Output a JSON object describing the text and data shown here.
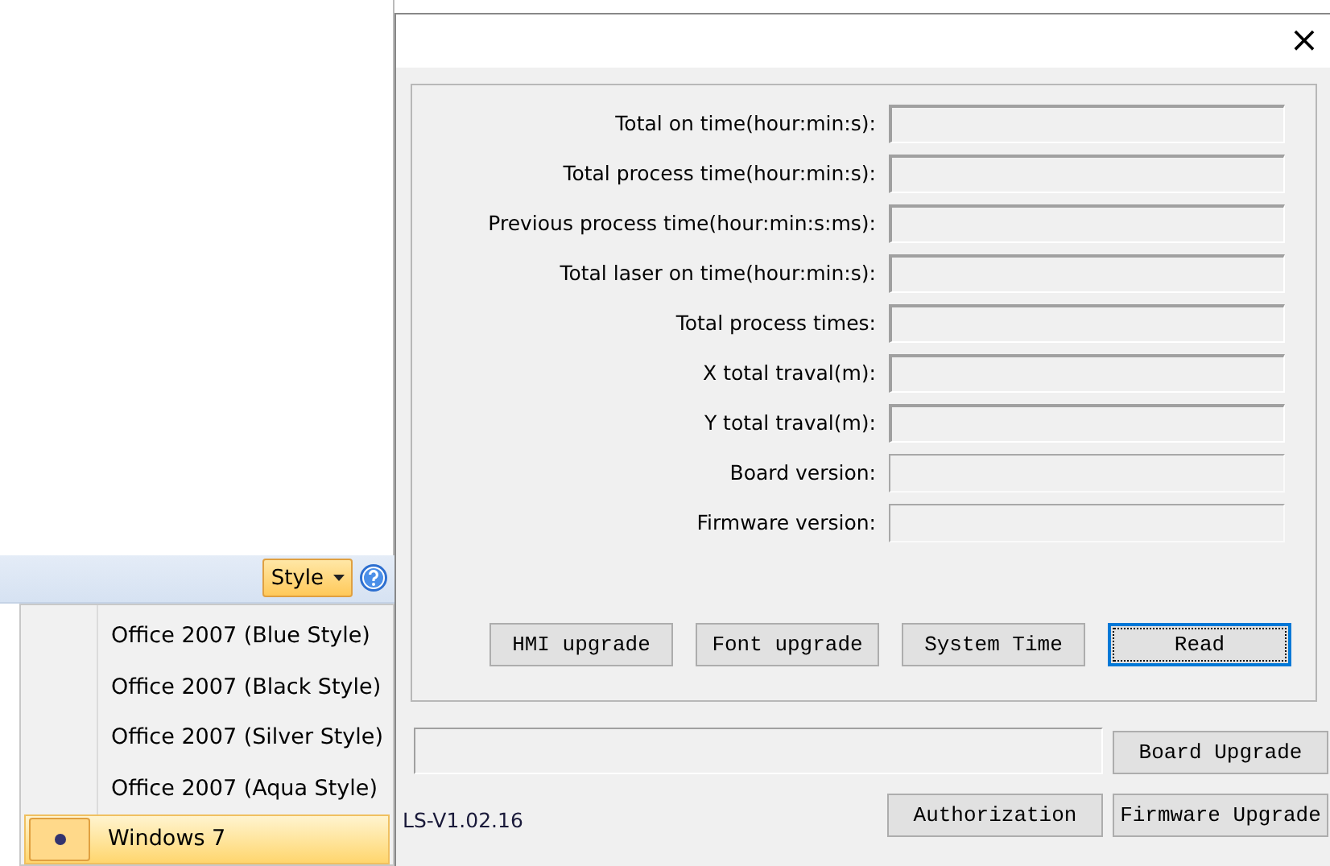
{
  "toolbar": {
    "style_button": "Style"
  },
  "style_menu": [
    {
      "label": "Office 2007 (Blue Style)",
      "selected": false
    },
    {
      "label": "Office 2007 (Black Style)",
      "selected": false
    },
    {
      "label": "Office 2007 (Silver Style)",
      "selected": false
    },
    {
      "label": "Office 2007 (Aqua Style)",
      "selected": false
    },
    {
      "label": "Windows 7",
      "selected": true
    }
  ],
  "dialog": {
    "close": "×",
    "fields": [
      {
        "label": "Total on time(hour:min:s):",
        "kind": "sunken"
      },
      {
        "label": "Total process time(hour:min:s):",
        "kind": "sunken"
      },
      {
        "label": "Previous process time(hour:min:s:ms):",
        "kind": "sunken"
      },
      {
        "label": "Total laser on time(hour:min:s):",
        "kind": "sunken"
      },
      {
        "label": "Total process times:",
        "kind": "sunken"
      },
      {
        "label": "X total traval(m):",
        "kind": "sunken"
      },
      {
        "label": "Y total traval(m):",
        "kind": "sunken"
      },
      {
        "label": "Board version:",
        "kind": "flat"
      },
      {
        "label": "Firmware version:",
        "kind": "flat"
      }
    ],
    "buttons": [
      {
        "label": "HMI upgrade",
        "focused": false
      },
      {
        "label": "Font upgrade",
        "focused": false
      },
      {
        "label": "System Time",
        "focused": false
      },
      {
        "label": "Read",
        "focused": true
      }
    ],
    "board_upgrade": "Board Upgrade",
    "version": "LS-V1.02.16",
    "authorization": "Authorization",
    "firmware_upgrade": "Firmware Upgrade"
  }
}
